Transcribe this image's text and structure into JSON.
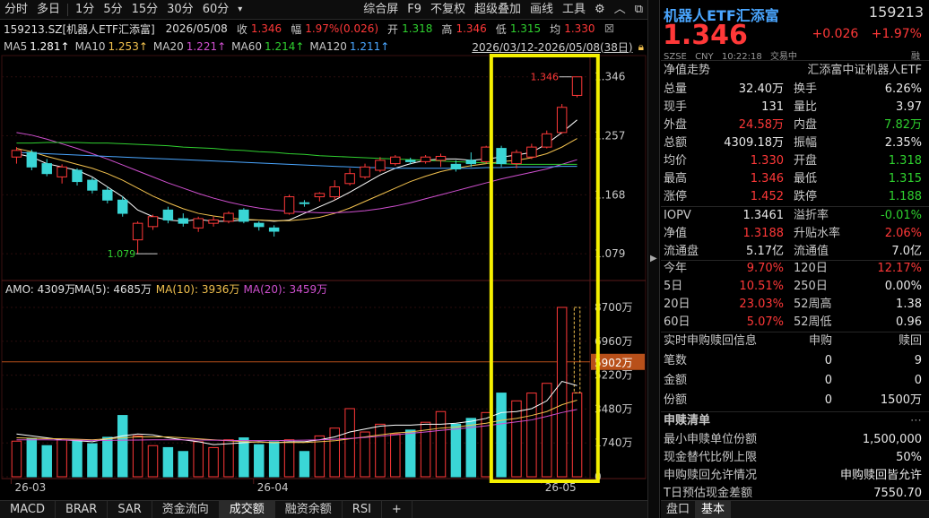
{
  "toolbar": {
    "items": [
      "分时",
      "多日",
      "1分",
      "5分",
      "15分",
      "30分",
      "60分",
      "▾"
    ],
    "right_items": [
      "综合屏",
      "F9",
      "不复权",
      "超级叠加",
      "画线",
      "工具"
    ]
  },
  "info": {
    "code_name": "159213.SZ[机器人ETF汇添富]",
    "date": "2026/05/08",
    "close_label": "收",
    "close_value": "1.346",
    "amp_label": "幅",
    "amp_value": "1.97%(0.026)",
    "open_label": "开",
    "open_value": "1.318",
    "high_label": "高",
    "high_value": "1.346",
    "low_label": "低",
    "low_value": "1.315",
    "avg_label": "均",
    "avg_value": "1.330"
  },
  "ma": [
    {
      "label": "MA5",
      "value": "1.281↑",
      "color": "#ffffff"
    },
    {
      "label": "MA10",
      "value": "1.253↑",
      "color": "#f2c14e"
    },
    {
      "label": "MA20",
      "value": "1.221↑",
      "color": "#d050d0"
    },
    {
      "label": "MA60",
      "value": "1.214↑",
      "color": "#30d030"
    },
    {
      "label": "MA120",
      "value": "1.211↑",
      "color": "#4aa6ff"
    }
  ],
  "range_label": "2026/03/12-2026/05/08(38日)",
  "chart": {
    "price_ticks": [
      "1.346",
      "1.257",
      "1.168",
      "1.079"
    ],
    "price_tick_values": [
      1.346,
      1.257,
      1.168,
      1.079
    ],
    "high_marker": "1.346",
    "low_marker": "1.079",
    "amo_title": "AMO: 4309万",
    "amo_ma5": "MA(5): 4685万",
    "amo_ma10": "MA(10): 3936万",
    "amo_ma20": "MA(20): 3459万",
    "vol_ticks": [
      "8700万",
      "6960万",
      "5220万",
      "3480万",
      "1740万",
      "0"
    ],
    "vol_tick_values": [
      8700,
      6960,
      5220,
      3480,
      1740,
      0
    ],
    "vol_marker": "5902万",
    "vol_marker_value": 5902,
    "date_labels": [
      "26-03",
      "26-04",
      "26-05"
    ],
    "date_label_index": [
      0,
      16,
      35
    ]
  },
  "chart_data": {
    "type": "candlestick",
    "candles": [
      {
        "o": 1.225,
        "c": 1.235,
        "h": 1.24,
        "l": 1.215,
        "v": 1830
      },
      {
        "o": 1.232,
        "c": 1.21,
        "h": 1.236,
        "l": 1.205,
        "v": 1950
      },
      {
        "o": 1.215,
        "c": 1.2,
        "h": 1.222,
        "l": 1.196,
        "v": 1600
      },
      {
        "o": 1.195,
        "c": 1.21,
        "h": 1.214,
        "l": 1.185,
        "v": 1900
      },
      {
        "o": 1.205,
        "c": 1.188,
        "h": 1.208,
        "l": 1.182,
        "v": 1830
      },
      {
        "o": 1.19,
        "c": 1.175,
        "h": 1.194,
        "l": 1.17,
        "v": 1700
      },
      {
        "o": 1.175,
        "c": 1.16,
        "h": 1.18,
        "l": 1.155,
        "v": 2030
      },
      {
        "o": 1.16,
        "c": 1.14,
        "h": 1.166,
        "l": 1.135,
        "v": 3150
      },
      {
        "o": 1.1,
        "c": 1.125,
        "h": 1.128,
        "l": 1.079,
        "v": 2100
      },
      {
        "o": 1.12,
        "c": 1.135,
        "h": 1.138,
        "l": 1.115,
        "v": 1600
      },
      {
        "o": 1.145,
        "c": 1.13,
        "h": 1.15,
        "l": 1.125,
        "v": 1500
      },
      {
        "o": 1.132,
        "c": 1.125,
        "h": 1.14,
        "l": 1.12,
        "v": 1300
      },
      {
        "o": 1.118,
        "c": 1.132,
        "h": 1.135,
        "l": 1.112,
        "v": 1800
      },
      {
        "o": 1.125,
        "c": 1.13,
        "h": 1.135,
        "l": 1.12,
        "v": 1500
      },
      {
        "o": 1.128,
        "c": 1.14,
        "h": 1.143,
        "l": 1.125,
        "v": 1900
      },
      {
        "o": 1.145,
        "c": 1.128,
        "h": 1.148,
        "l": 1.125,
        "v": 2000
      },
      {
        "o": 1.125,
        "c": 1.12,
        "h": 1.128,
        "l": 1.114,
        "v": 1650
      },
      {
        "o": 1.118,
        "c": 1.113,
        "h": 1.122,
        "l": 1.105,
        "v": 1800
      },
      {
        "o": 1.14,
        "c": 1.165,
        "h": 1.168,
        "l": 1.138,
        "v": 1900
      },
      {
        "o": 1.156,
        "c": 1.155,
        "h": 1.16,
        "l": 1.15,
        "v": 1300
      },
      {
        "o": 1.165,
        "c": 1.17,
        "h": 1.172,
        "l": 1.158,
        "v": 2100
      },
      {
        "o": 1.165,
        "c": 1.18,
        "h": 1.19,
        "l": 1.16,
        "v": 2500
      },
      {
        "o": 1.185,
        "c": 1.2,
        "h": 1.208,
        "l": 1.182,
        "v": 3500
      },
      {
        "o": 1.195,
        "c": 1.21,
        "h": 1.215,
        "l": 1.192,
        "v": 2300
      },
      {
        "o": 1.205,
        "c": 1.22,
        "h": 1.225,
        "l": 1.202,
        "v": 2700
      },
      {
        "o": 1.215,
        "c": 1.225,
        "h": 1.228,
        "l": 1.212,
        "v": 2200
      },
      {
        "o": 1.22,
        "c": 1.218,
        "h": 1.224,
        "l": 1.214,
        "v": 2400
      },
      {
        "o": 1.218,
        "c": 1.225,
        "h": 1.228,
        "l": 1.215,
        "v": 2800
      },
      {
        "o": 1.22,
        "c": 1.226,
        "h": 1.23,
        "l": 1.21,
        "v": 3350
      },
      {
        "o": 1.214,
        "c": 1.207,
        "h": 1.22,
        "l": 1.203,
        "v": 2700
      },
      {
        "o": 1.22,
        "c": 1.215,
        "h": 1.232,
        "l": 1.21,
        "v": 3000
      },
      {
        "o": 1.218,
        "c": 1.24,
        "h": 1.242,
        "l": 1.215,
        "v": 3300
      },
      {
        "o": 1.238,
        "c": 1.215,
        "h": 1.242,
        "l": 1.21,
        "v": 4300
      },
      {
        "o": 1.215,
        "c": 1.232,
        "h": 1.236,
        "l": 1.208,
        "v": 3900
      },
      {
        "o": 1.225,
        "c": 1.24,
        "h": 1.245,
        "l": 1.222,
        "v": 4300
      },
      {
        "o": 1.24,
        "c": 1.26,
        "h": 1.265,
        "l": 1.238,
        "v": 4800
      },
      {
        "o": 1.262,
        "c": 1.3,
        "h": 1.305,
        "l": 1.26,
        "v": 8700
      },
      {
        "o": 1.318,
        "c": 1.346,
        "h": 1.346,
        "l": 1.315,
        "v": 4309
      }
    ],
    "ma5": [
      1.23,
      1.225,
      1.215,
      1.21,
      1.205,
      1.195,
      1.18,
      1.165,
      1.145,
      1.135,
      1.13,
      1.128,
      1.131,
      1.128,
      1.128,
      1.13,
      1.13,
      1.128,
      1.13,
      1.14,
      1.15,
      1.16,
      1.172,
      1.185,
      1.198,
      1.208,
      1.215,
      1.22,
      1.222,
      1.222,
      1.22,
      1.222,
      1.225,
      1.228,
      1.232,
      1.245,
      1.262,
      1.281
    ],
    "ma10": [
      1.238,
      1.233,
      1.226,
      1.22,
      1.214,
      1.208,
      1.2,
      1.19,
      1.178,
      1.166,
      1.156,
      1.147,
      1.14,
      1.136,
      1.133,
      1.131,
      1.13,
      1.129,
      1.129,
      1.131,
      1.134,
      1.14,
      1.148,
      1.158,
      1.168,
      1.178,
      1.188,
      1.196,
      1.203,
      1.208,
      1.212,
      1.215,
      1.218,
      1.22,
      1.224,
      1.23,
      1.24,
      1.253
    ],
    "ma20": [
      1.262,
      1.258,
      1.252,
      1.245,
      1.238,
      1.23,
      1.222,
      1.213,
      1.204,
      1.195,
      1.186,
      1.178,
      1.17,
      1.163,
      1.157,
      1.152,
      1.148,
      1.145,
      1.143,
      1.142,
      1.141,
      1.141,
      1.142,
      1.144,
      1.147,
      1.151,
      1.156,
      1.162,
      1.168,
      1.174,
      1.18,
      1.186,
      1.192,
      1.197,
      1.202,
      1.207,
      1.214,
      1.221
    ],
    "ma60": [
      1.246,
      1.246,
      1.247,
      1.247,
      1.247,
      1.246,
      1.246,
      1.245,
      1.244,
      1.243,
      1.242,
      1.24,
      1.239,
      1.238,
      1.236,
      1.235,
      1.233,
      1.232,
      1.23,
      1.229,
      1.227,
      1.226,
      1.225,
      1.224,
      1.223,
      1.222,
      1.221,
      1.22,
      1.219,
      1.218,
      1.217,
      1.216,
      1.215,
      1.214,
      1.214,
      1.214,
      1.214,
      1.214
    ],
    "ma120": [
      1.232,
      1.231,
      1.23,
      1.229,
      1.228,
      1.227,
      1.226,
      1.225,
      1.224,
      1.223,
      1.222,
      1.221,
      1.22,
      1.219,
      1.218,
      1.217,
      1.216,
      1.215,
      1.214,
      1.213,
      1.212,
      1.211,
      1.21,
      1.209,
      1.209,
      1.208,
      1.208,
      1.208,
      1.208,
      1.208,
      1.208,
      1.209,
      1.209,
      1.21,
      1.21,
      1.21,
      1.211,
      1.211
    ],
    "vma5": [
      2200,
      2100,
      2000,
      1900,
      1850,
      1800,
      1950,
      2100,
      2200,
      2150,
      2000,
      1900,
      1800,
      1650,
      1700,
      1750,
      1800,
      1750,
      1800,
      1800,
      1900,
      2050,
      2300,
      2450,
      2600,
      2650,
      2650,
      2700,
      2700,
      2750,
      2850,
      3000,
      3300,
      3350,
      3500,
      3900,
      4900,
      4685
    ],
    "vma10": [
      2000,
      1980,
      1960,
      1950,
      1930,
      1900,
      1950,
      2000,
      2050,
      2050,
      2050,
      2000,
      1950,
      1900,
      1850,
      1800,
      1780,
      1760,
      1760,
      1760,
      1800,
      1850,
      1950,
      2050,
      2150,
      2250,
      2300,
      2400,
      2500,
      2550,
      2650,
      2750,
      2900,
      3000,
      3150,
      3350,
      3700,
      3936
    ],
    "vma20": [
      1900,
      1900,
      1900,
      1890,
      1880,
      1870,
      1870,
      1880,
      1890,
      1900,
      1900,
      1900,
      1890,
      1880,
      1870,
      1860,
      1860,
      1860,
      1870,
      1880,
      1900,
      1930,
      1970,
      2020,
      2080,
      2150,
      2230,
      2300,
      2380,
      2450,
      2530,
      2620,
      2720,
      2820,
      2920,
      3100,
      3300,
      3459
    ],
    "price_range": [
      1.04,
      1.37
    ],
    "vol_range": [
      0,
      8700
    ]
  },
  "right": {
    "title": "机器人ETF汇添富",
    "code": "159213",
    "price": "1.346",
    "change": "+0.026",
    "change_pct": "+1.97%",
    "market": "SZSE",
    "currency": "CNY",
    "time": "10:22:18",
    "status": "交易中",
    "rong": "融",
    "nav_trend_label": "净值走势",
    "nav_trend_value": "汇添富中证机器人ETF",
    "rows": [
      {
        "l1": "总量",
        "v1": "32.40万",
        "c1": "white",
        "l2": "换手",
        "v2": "6.26%",
        "c2": "white"
      },
      {
        "l1": "现手",
        "v1": "131",
        "c1": "white",
        "l2": "量比",
        "v2": "3.97",
        "c2": "white"
      },
      {
        "l1": "外盘",
        "v1": "24.58万",
        "c1": "red",
        "l2": "内盘",
        "v2": "7.82万",
        "c2": "green"
      },
      {
        "l1": "总额",
        "v1": "4309.18万",
        "c1": "white",
        "l2": "振幅",
        "v2": "2.35%",
        "c2": "white"
      },
      {
        "l1": "均价",
        "v1": "1.330",
        "c1": "red",
        "l2": "开盘",
        "v2": "1.318",
        "c2": "green"
      },
      {
        "l1": "最高",
        "v1": "1.346",
        "c1": "red",
        "l2": "最低",
        "v2": "1.315",
        "c2": "green"
      },
      {
        "l1": "涨停",
        "v1": "1.452",
        "c1": "red",
        "l2": "跌停",
        "v2": "1.188",
        "c2": "green"
      }
    ],
    "rows2": [
      {
        "l1": "IOPV",
        "v1": "1.3461",
        "c1": "white",
        "l2": "溢折率",
        "v2": "-0.01%",
        "c2": "green"
      },
      {
        "l1": "净值",
        "v1": "1.3188",
        "c1": "red",
        "l2": "升贴水率",
        "v2": "2.06%",
        "c2": "red"
      },
      {
        "l1": "流通盘",
        "v1": "5.17亿",
        "c1": "white",
        "l2": "流通值",
        "v2": "7.0亿",
        "c2": "white"
      }
    ],
    "rows3": [
      {
        "l1": "今年",
        "v1": "9.70%",
        "c1": "red",
        "l2": "120日",
        "v2": "12.17%",
        "c2": "red"
      },
      {
        "l1": "5日",
        "v1": "10.51%",
        "c1": "red",
        "l2": "250日",
        "v2": "0.00%",
        "c2": "white"
      },
      {
        "l1": "20日",
        "v1": "23.03%",
        "c1": "red",
        "l2": "52周高",
        "v2": "1.38",
        "c2": "white"
      },
      {
        "l1": "60日",
        "v1": "5.07%",
        "c1": "red",
        "l2": "52周低",
        "v2": "0.96",
        "c2": "white"
      }
    ],
    "redeem_title": "实时申购赎回信息",
    "redeem_col1": "申购",
    "redeem_col2": "赎回",
    "redeem_rows": [
      {
        "label": "笔数",
        "a": "0",
        "b": "9"
      },
      {
        "label": "金额",
        "a": "0",
        "b": "0"
      },
      {
        "label": "份额",
        "a": "0",
        "b": "1500万"
      }
    ],
    "list_title": "申赎清单",
    "list_rows": [
      {
        "label": "最小申赎单位份额",
        "value": "1,500,000"
      },
      {
        "label": "现金替代比例上限",
        "value": "50%"
      },
      {
        "label": "申购赎回允许情况",
        "value": "申购赎回皆允许"
      },
      {
        "label": "T日预估现金差额",
        "value": "7550.70"
      }
    ],
    "tabs": [
      "盘口",
      "基本"
    ]
  },
  "bottom_tabs": [
    "MACD",
    "BRAR",
    "SAR",
    "资金流向",
    "成交额",
    "融资余额",
    "RSI",
    "+"
  ]
}
